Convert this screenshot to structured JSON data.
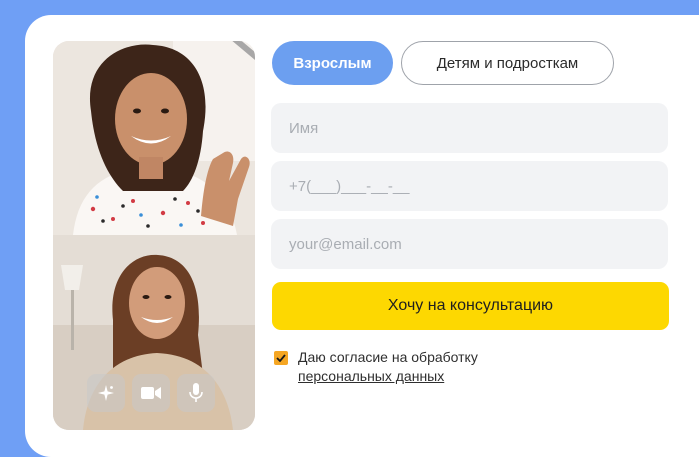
{
  "tabs": [
    {
      "label": "Взрослым",
      "active": true
    },
    {
      "label": "Детям и подросткам",
      "active": false
    }
  ],
  "form": {
    "name_placeholder": "Имя",
    "phone_placeholder": "+7(___)___-__-__",
    "email_placeholder": "your@email.com",
    "submit_label": "Хочу на консультацию"
  },
  "consent": {
    "checked": true,
    "text": "Даю согласие на обработку",
    "link": "персональных данных"
  },
  "media": {
    "controls": [
      "sparkle-icon",
      "video-camera-icon",
      "microphone-icon"
    ]
  },
  "colors": {
    "background": "#6f9ff5",
    "accent_blue": "#6c9ff0",
    "submit_yellow": "#fdd801",
    "checkbox_orange": "#f5a623"
  }
}
